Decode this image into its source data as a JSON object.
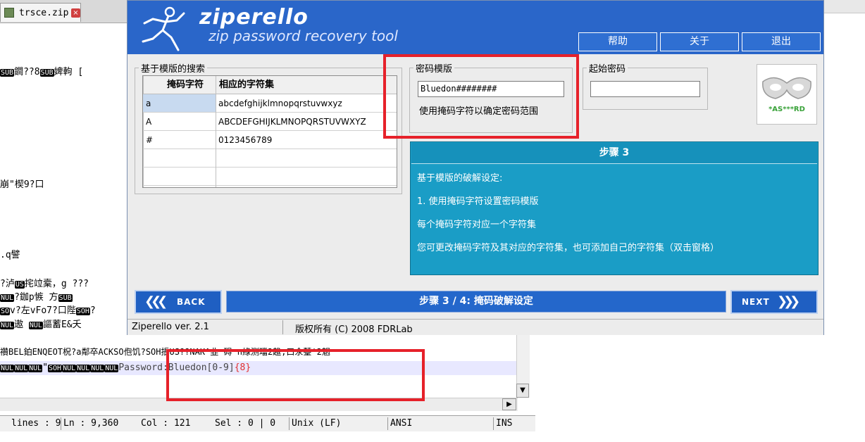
{
  "editor": {
    "tab_label": "trsce.zip",
    "tab_close": "×",
    "lines": [
      {
        "pre": "",
        "ctl": "SUB",
        "mid": "鐧??8",
        "ctl2": "SUB",
        "post": "婢軥  ["
      },
      {
        "text": "崩\"楔9?口"
      },
      {
        "text": ".q譬"
      },
      {
        "pre": "?泸",
        "ctl": "US",
        "mid": "挓竝槖，g ???"
      },
      {
        "pre": "  ",
        "ctl": "NUL",
        "mid": "?鉫p愱  方",
        "ctl2": "SUB"
      },
      {
        "pre": "",
        "ctl": "SO",
        "mid": "v?左vFo7?口陛",
        "ctl2": "SOH",
        "post": "?"
      },
      {
        "pre": "",
        "ctl": "NUL",
        "mid": "遨  ",
        "ctl2": "NUL",
        "post": "謳蓄E&夭"
      },
      {
        "text": "禶BEL鉑ENQEOT柷?a鄰卒ACKSO佨饥?SOH掁US??NAK^韭  碍  n綠测璫2趡,口氽鼞'2魍"
      }
    ],
    "password_line_prefix_ctl": [
      "NUL",
      "NUL",
      "NUL"
    ],
    "password_line_mid": "\"",
    "password_line_ctl2": [
      "SOH",
      "NUL",
      "NUL",
      "NUL",
      "NUL"
    ],
    "password_text": "Password:Bluedon[0-9]",
    "password_brace": "{8}",
    "status": {
      "lines": "lines : 9",
      "ln": "Ln : 9,360",
      "col": "Col : 121",
      "sel": "Sel : 0 | 0",
      "eol": "Unix (LF)",
      "enc": "ANSI",
      "ins": "INS"
    }
  },
  "ziperello": {
    "logo_title": "ziperello",
    "logo_subtitle": "zip password recovery tool",
    "header_buttons": [
      "帮助",
      "关于",
      "退出"
    ],
    "template_search_group": "基于模版的搜索",
    "table": {
      "headers": [
        "掩码字符",
        "相应的字符集"
      ],
      "rows": [
        [
          "a",
          "abcdefghijklmnopqrstuvwxyz"
        ],
        [
          "A",
          "ABCDEFGHIJKLMNOPQRSTUVWXYZ"
        ],
        [
          "#",
          "0123456789"
        ],
        [
          "",
          ""
        ],
        [
          "",
          ""
        ]
      ]
    },
    "password_template_group": "密码模版",
    "password_template_value": "Bluedon########",
    "password_template_hint": "使用掩码字符以确定密码范围",
    "start_password_group": "起始密码",
    "start_password_value": "",
    "badge_text": "*AS***RD",
    "step_panel": {
      "title": "步骤 3",
      "lines": [
        "基于模版的破解设定:",
        "1. 使用掩码字符设置密码模版",
        "每个掩码字符对应一个字符集",
        "您可更改掩码字符及其对应的字符集，也可添加自己的字符集（双击窗格）"
      ]
    },
    "nav": {
      "back": "BACK",
      "next": "NEXT",
      "step_label": "步骤 3 / 4: 掩码破解设定"
    },
    "status": {
      "version": "Ziperello ver. 2.1",
      "copyright": "版权所有 (C) 2008 FDRLab"
    },
    "colors": {
      "header_blue": "#2a66c9",
      "step_panel": "#1a9dc6",
      "highlight_red": "#e6212a"
    }
  }
}
